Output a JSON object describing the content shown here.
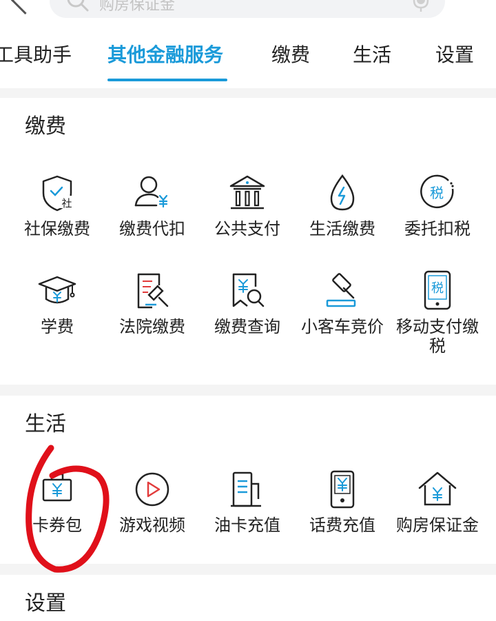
{
  "search": {
    "placeholder": "购房保证金"
  },
  "tabs": [
    {
      "label": "工具助手"
    },
    {
      "label": "其他金融服务",
      "active": true
    },
    {
      "label": "缴费"
    },
    {
      "label": "生活"
    },
    {
      "label": "设置"
    }
  ],
  "sections": {
    "payment": {
      "title": "缴费",
      "items": [
        {
          "label": "社保缴费",
          "icon": "social-security-icon"
        },
        {
          "label": "缴费代扣",
          "icon": "user-yuan-icon"
        },
        {
          "label": "公共支付",
          "icon": "bank-building-icon"
        },
        {
          "label": "生活缴费",
          "icon": "water-drop-icon"
        },
        {
          "label": "委托扣税",
          "icon": "tax-circle-icon"
        },
        {
          "label": "学费",
          "icon": "graduation-cap-icon"
        },
        {
          "label": "法院缴费",
          "icon": "document-gavel-icon"
        },
        {
          "label": "缴费查询",
          "icon": "bill-search-icon"
        },
        {
          "label": "小客车竞价",
          "icon": "auction-hammer-icon"
        },
        {
          "label": "移动支付缴税",
          "icon": "mobile-tax-icon"
        }
      ]
    },
    "life": {
      "title": "生活",
      "items": [
        {
          "label": "卡券包",
          "icon": "coupon-bag-icon"
        },
        {
          "label": "游戏视频",
          "icon": "play-circle-icon"
        },
        {
          "label": "油卡充值",
          "icon": "fuel-card-icon"
        },
        {
          "label": "话费充值",
          "icon": "phone-topup-icon"
        },
        {
          "label": "购房保证金",
          "icon": "house-yuan-icon"
        }
      ]
    },
    "settings": {
      "title": "设置"
    }
  },
  "colors": {
    "accent": "#1a9ad9",
    "icon_dark": "#222222",
    "annotation": "#e0101a"
  }
}
